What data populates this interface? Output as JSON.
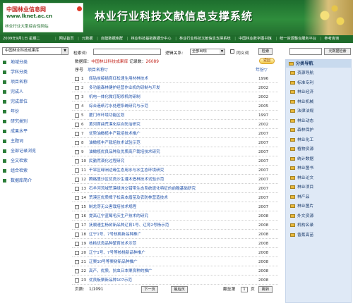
{
  "header": {
    "logo_cn": "中国林业信息网",
    "logo_url": "www.lknet.ac.cn",
    "logo_sub": "林业行业大型综合性网站",
    "site_title": "林业行业科技文献信息支撑系统"
  },
  "nav": {
    "date": "2009年9月1日 星期二",
    "links": [
      "网站首页",
      "元数据",
      "自建数据库群",
      "林业科技基础数据分中心",
      "林业行业科技文献信息支撑系统",
      "中国林业数字图书馆",
      "统一资源整合服务平台",
      "参考咨询"
    ]
  },
  "left": {
    "db_select": "中国林业科技成果库",
    "items": [
      "地域分类",
      "学科分类",
      "项目名称",
      "完成人",
      "完成单位",
      "年份",
      "研究类别",
      "成果水平",
      "主题词",
      "全部记录浏览",
      "全文检索",
      "组合检索",
      "数据库简介"
    ]
  },
  "search": {
    "label": "检索词:",
    "logic_label": "逻辑关系:",
    "logic_value": "全部出现",
    "same_label": "同义词",
    "button": "检索"
  },
  "dbline": {
    "prefix": "数据库：",
    "db_name": "中国林业科技成果库",
    "count_label": "记录数：",
    "count": "26089",
    "return_label": "返回"
  },
  "table": {
    "col_no": "序号",
    "col_title": "项目名称▽",
    "col_year": "年份▽",
    "rows": [
      {
        "no": "1",
        "title": "辉钻炭接插育红松速生用材林技术",
        "year": "1996"
      },
      {
        "no": "2",
        "title": "多功能森林健护经营作业机的研制与开发",
        "year": "2002"
      },
      {
        "no": "3",
        "title": "机电一体化微灯配修机的研制",
        "year": "2002"
      },
      {
        "no": "4",
        "title": "综合造纸污水处理系统研究与示范",
        "year": "2005"
      },
      {
        "no": "5",
        "title": "厦门市环境功能区划",
        "year": "1997"
      },
      {
        "no": "6",
        "title": "黄河首曲荒漠化综合防治研究",
        "year": "2002"
      },
      {
        "no": "7",
        "title": "优势油橄榄丰产栽培技术推广",
        "year": "2007"
      },
      {
        "no": "8",
        "title": "油橄榄丰产栽培技术试验示范",
        "year": "2007"
      },
      {
        "no": "9",
        "title": "油橄榄优良品种及优质高产栽培技术研究",
        "year": "2007"
      },
      {
        "no": "10",
        "title": "民勤荒漠化过程研究",
        "year": "2007"
      },
      {
        "no": "11",
        "title": "干旱区绿洲边缘生态用水与水生态环境研究",
        "year": "2007"
      },
      {
        "no": "12",
        "title": "腾格里沙区优良沙生灌木造林技术试验示范",
        "year": "2007"
      },
      {
        "no": "13",
        "title": "石羊河流域荒漠绿洲交错带生态系统退化特征的前瞻基础研究",
        "year": "2007"
      },
      {
        "no": "14",
        "title": "荒漠区优质樟子松高本盾苗及农防林营造技术",
        "year": "2007"
      },
      {
        "no": "15",
        "title": "制龙芽无公害栽培技术规程",
        "year": "2007"
      },
      {
        "no": "16",
        "title": "提高辽宁蓝莓毛庆生产技术的研究",
        "year": "2008"
      },
      {
        "no": "17",
        "title": "抚顺速生杨树新品种辽育1号、辽育2号杨示范",
        "year": "2008"
      },
      {
        "no": "18",
        "title": "辽宁1号、7号核桃新品种推广",
        "year": "2008"
      },
      {
        "no": "19",
        "title": "核桃优良品种繁育技术示范",
        "year": "2008"
      },
      {
        "no": "20",
        "title": "辽宁1号、7号等核桃新品种推广",
        "year": "2008"
      },
      {
        "no": "21",
        "title": "辽栗10号等栗树新品种推广",
        "year": "2008"
      },
      {
        "no": "22",
        "title": "高产、优质、抗虫日本栗良种的推广",
        "year": "2008"
      },
      {
        "no": "23",
        "title": "优良板栗新品种107示范",
        "year": "2008"
      }
    ]
  },
  "pager": {
    "label": "页数:",
    "value": "1/1091",
    "next": "下一页",
    "last": "最后页",
    "goto_label": "翻至第",
    "goto_value": "1",
    "goto_unit": "页",
    "jump": "跳转"
  },
  "right": {
    "button": "元数据检索",
    "head": "分类导航",
    "items": [
      "资源导航",
      "标准专利",
      "林业经济",
      "林业机械",
      "法律法规",
      "林业动态",
      "森林保护",
      "林业化工",
      "植物资源",
      "统计数据",
      "林业图书",
      "林业论文",
      "林业项目",
      "林产品",
      "林业图片",
      "外文资源",
      "机构名录",
      "香蕉高苗"
    ]
  },
  "colors": {
    "header_green": "#2f8d3c",
    "nav_green": "#1f6b2b",
    "link_blue": "#1e4fa8",
    "accent_red": "#c2231a",
    "panel_blue": "#dfe9f6"
  }
}
